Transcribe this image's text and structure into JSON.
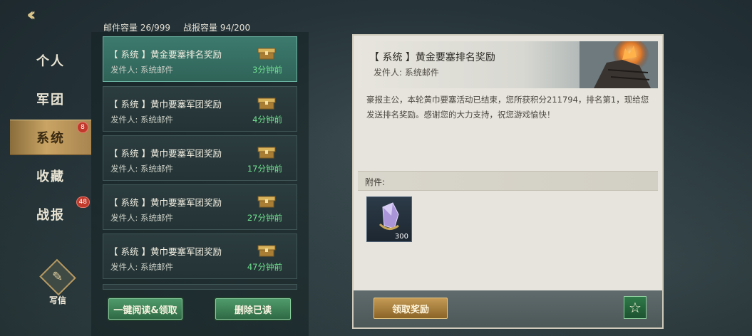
{
  "nav": {
    "back_icon": "chevron-left-double-icon",
    "items": [
      {
        "label": "个人",
        "badge": ""
      },
      {
        "label": "军团",
        "badge": ""
      },
      {
        "label": "系统",
        "badge": "8"
      },
      {
        "label": "收藏",
        "badge": ""
      },
      {
        "label": "战报",
        "badge": "48"
      }
    ],
    "write_label": "写信"
  },
  "capacity": {
    "mail": "邮件容量 26/999",
    "report": "战报容量 94/200"
  },
  "mails": [
    {
      "title": "【 系统 】黄金要塞排名奖励",
      "sender": "发件人: 系统邮件",
      "time": "3分钟前"
    },
    {
      "title": "【 系统 】黄巾要塞军团奖励",
      "sender": "发件人: 系统邮件",
      "time": "4分钟前"
    },
    {
      "title": "【 系统 】黄巾要塞军团奖励",
      "sender": "发件人: 系统邮件",
      "time": "17分钟前"
    },
    {
      "title": "【 系统 】黄巾要塞军团奖励",
      "sender": "发件人: 系统邮件",
      "time": "27分钟前"
    },
    {
      "title": "【 系统 】黄巾要塞军团奖励",
      "sender": "发件人: 系统邮件",
      "time": "47分钟前"
    }
  ],
  "list_buttons": {
    "read_all": "一键阅读&领取",
    "delete_read": "删除已读"
  },
  "detail": {
    "title": "【 系统 】黄金要塞排名奖励",
    "sender": "发件人: 系统邮件",
    "body": "豪报主公，本轮黄巾要塞活动已结束，您所获积分211794，排名第1，现给您发送排名奖励。感谢您的大力支持，祝您游戏愉快！",
    "attachment_label": "附件:",
    "attachment_count": "300",
    "claim_button": "领取奖励",
    "star_icon": "star-icon"
  },
  "colors": {
    "accent_green": "#6fe08f",
    "gold": "#c9a464",
    "badge_red": "#c0392b"
  }
}
